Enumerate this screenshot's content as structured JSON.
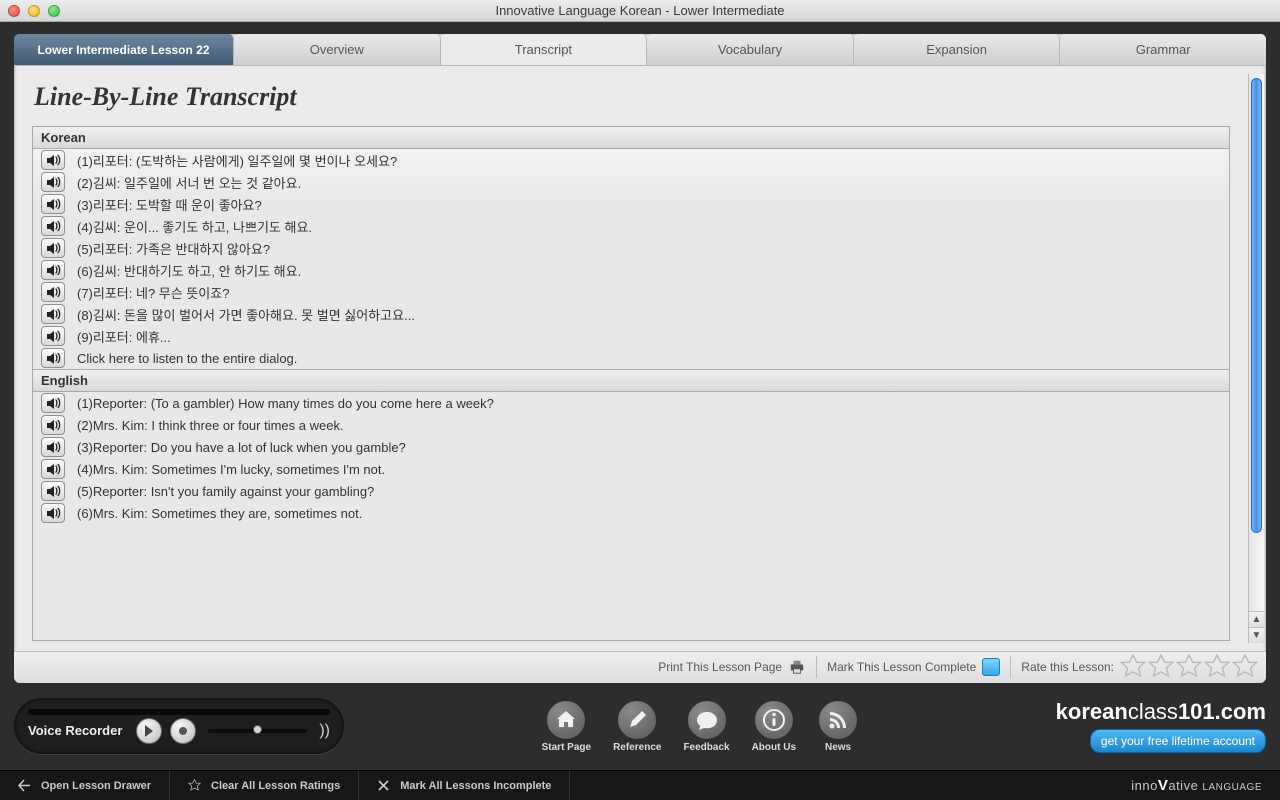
{
  "window": {
    "title": "Innovative Language Korean - Lower Intermediate"
  },
  "tabs": {
    "lesson_label": "Lower Intermediate Lesson 22",
    "items": [
      "Overview",
      "Transcript",
      "Vocabulary",
      "Expansion",
      "Grammar"
    ],
    "active_index": 1
  },
  "page": {
    "heading": "Line-By-Line Transcript",
    "sections": [
      {
        "title": "Korean",
        "lines": [
          "(1)리포터: (도박하는 사람에게) 일주일에 몇 번이나 오세요?",
          "(2)김씨: 일주일에 서너 번 오는 것 같아요.",
          "(3)리포터: 도박할 때 운이 좋아요?",
          "(4)김씨: 운이... 좋기도 하고, 나쁘기도 해요.",
          "(5)리포터: 가족은 반대하지 않아요?",
          "(6)김씨: 반대하기도 하고, 안 하기도 해요.",
          "(7)리포터: 네? 무슨 뜻이죠?",
          "(8)김씨: 돈을 많이 벌어서 가면 좋아해요. 못 벌면 싫어하고요...",
          "(9)리포터: 에휴...",
          "Click here to listen to the entire dialog."
        ]
      },
      {
        "title": "English",
        "lines": [
          "(1)Reporter: (To a gambler) How many times do you come here a week?",
          "(2)Mrs. Kim: I think three or four times a week.",
          "(3)Reporter: Do you have a lot of luck when you gamble?",
          "(4)Mrs. Kim: Sometimes I'm lucky, sometimes I'm not.",
          "(5)Reporter: Isn't you family against your gambling?",
          "(6)Mrs. Kim: Sometimes they are, sometimes not."
        ]
      }
    ]
  },
  "status": {
    "print": "Print This Lesson Page",
    "mark_complete": "Mark This Lesson Complete",
    "rate": "Rate this Lesson:"
  },
  "recorder": {
    "label": "Voice Recorder"
  },
  "nav": [
    {
      "id": "home-icon",
      "label": "Start Page"
    },
    {
      "id": "pen-icon",
      "label": "Reference"
    },
    {
      "id": "chat-icon",
      "label": "Feedback"
    },
    {
      "id": "info-icon",
      "label": "About Us"
    },
    {
      "id": "rss-icon",
      "label": "News"
    }
  ],
  "promo": {
    "brand_prefix": "korean",
    "brand_mid": "class",
    "brand_suffix": "101.com",
    "cta": "get your free lifetime account"
  },
  "bottombar": {
    "open_drawer": "Open Lesson Drawer",
    "clear_ratings": "Clear All Lesson Ratings",
    "mark_incomplete": "Mark All Lessons Incomplete",
    "brand": "innoVative LANGUAGE"
  }
}
